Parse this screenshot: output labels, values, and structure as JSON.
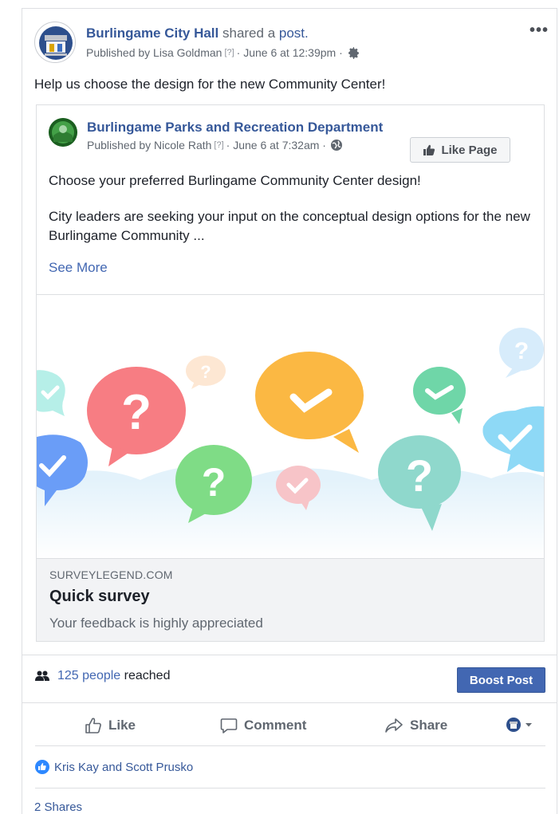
{
  "post": {
    "page_name": "Burlingame City Hall",
    "shared_text": " shared a ",
    "post_link": "post.",
    "published_prefix": "Published by Lisa Goldman",
    "help_marker": "[?]",
    "date": "· June 6 at 12:39pm ·",
    "more": "•••",
    "message": "Help us choose the design for the new Community Center!"
  },
  "shared_post": {
    "page_name": "Burlingame Parks and Recreation Department",
    "published_prefix": "Published by Nicole Rath",
    "help_marker": "[?]",
    "date": "· June 6 at 7:32am ·",
    "like_page_label": "Like Page",
    "text1": "Choose your preferred Burlingame Community Center design!",
    "text2": "City leaders are seeking your input on the conceptual design options for the new Burlingame Community ...",
    "see_more": "See More",
    "link": {
      "domain": "SURVEYLEGEND.COM",
      "title": "Quick survey",
      "description": "Your feedback is highly appreciated"
    }
  },
  "reach": {
    "count_text": "125 people",
    "suffix": "reached",
    "boost_label": "Boost Post"
  },
  "actions": {
    "like": "Like",
    "comment": "Comment",
    "share": "Share"
  },
  "engagement": {
    "likes_text": "Kris Kay and Scott Prusko",
    "shares_text": "2 Shares"
  },
  "colors": {
    "link": "#365899",
    "button": "#4267b2"
  }
}
